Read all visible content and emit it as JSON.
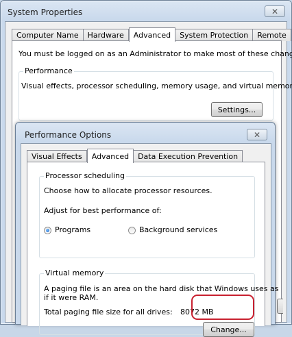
{
  "system_properties": {
    "title": "System Properties",
    "close_glyph": "✕",
    "tabs": [
      "Computer Name",
      "Hardware",
      "Advanced",
      "System Protection",
      "Remote"
    ],
    "active_tab": "Advanced",
    "admin_note": "You must be logged on as an Administrator to make most of these changes.",
    "performance": {
      "label": "Performance",
      "description": "Visual effects, processor scheduling, memory usage, and virtual memory",
      "settings_button": "Settings..."
    }
  },
  "performance_options": {
    "title": "Performance Options",
    "close_glyph": "✕",
    "tabs": [
      "Visual Effects",
      "Advanced",
      "Data Execution Prevention"
    ],
    "active_tab": "Advanced",
    "processor_scheduling": {
      "label": "Processor scheduling",
      "description": "Choose how to allocate processor resources.",
      "adjust_label": "Adjust for best performance of:",
      "options": [
        "Programs",
        "Background services"
      ],
      "selected": "Programs"
    },
    "virtual_memory": {
      "label": "Virtual memory",
      "description_line1": "A paging file is an area on the hard disk that Windows uses as",
      "description_line2": "if it were RAM.",
      "total_label": "Total paging file size for all drives:",
      "total_value": "8072 MB",
      "change_button": "Change..."
    }
  },
  "colors": {
    "highlight": "#c8202f",
    "radio_selected": "#1a62c5"
  }
}
